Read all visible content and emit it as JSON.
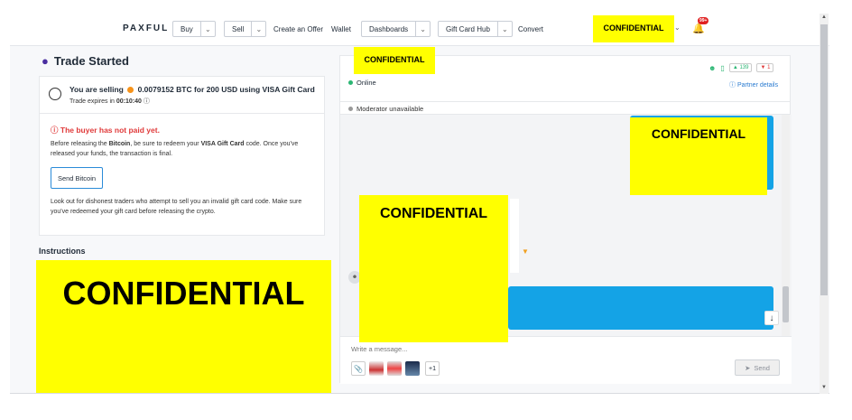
{
  "nav": {
    "logo": "PAXFUL",
    "buy": "Buy",
    "sell": "Sell",
    "create_offer": "Create an Offer",
    "wallet": "Wallet",
    "dashboards": "Dashboards",
    "gift_card_hub": "Gift Card Hub",
    "convert": "Convert",
    "user_redacted": "CONFIDENTIAL",
    "notifications_badge": "99+"
  },
  "trade": {
    "title": "Trade Started",
    "selling_prefix": "You are selling",
    "selling_detail": "0.0079152 BTC for 200 USD using VISA Gift Card",
    "expires_label": "Trade expires in",
    "expires_time": "00:10:40",
    "alert": "The buyer has not paid yet.",
    "notice_1": "Before releasing the ",
    "notice_bitcoin": "Bitcoin",
    "notice_2": ", be sure to redeem your ",
    "notice_card": "VISA Gift Card",
    "notice_3": " code. Once you've released your funds, the transaction is final.",
    "send_button": "Send Bitcoin",
    "warning": "Look out for dishonest traders who attempt to sell you an invalid gift card code. Make sure you've redeemed your gift card before releasing the crypto."
  },
  "instructions": {
    "heading": "Instructions",
    "redacted": "CONFIDENTIAL"
  },
  "chat": {
    "partner_redacted": "CONFIDENTIAL",
    "status": "Online",
    "likes": "139",
    "dislikes": "1",
    "partner_details": "Partner details",
    "moderator": "Moderator unavailable",
    "redacted_1": "CONFIDENTIAL",
    "redacted_2": "CONFIDENTIAL",
    "placeholder": "Write a message...",
    "attachments_more": "+1",
    "send": "Send"
  },
  "colors": {
    "accent_blue": "#14a3e6",
    "alert_red": "#e03a3a",
    "online_green": "#2bb673",
    "redaction_yellow": "#ffff00"
  }
}
